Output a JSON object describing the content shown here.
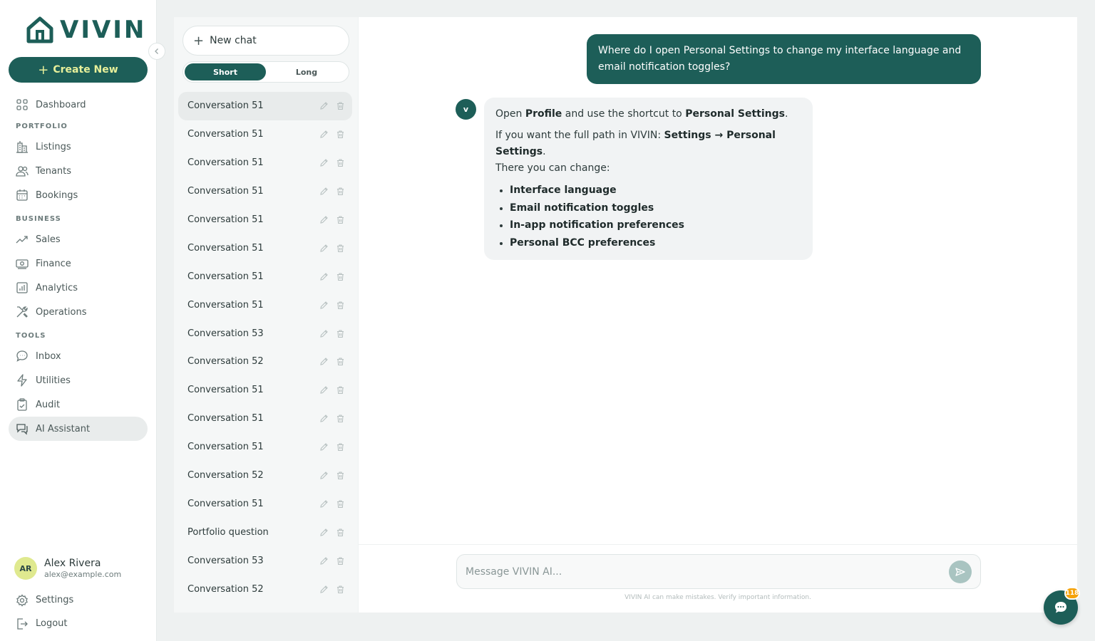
{
  "brand": {
    "name": "VIVIN",
    "color": "#1d5e58",
    "accent": "#e8f09a"
  },
  "sidebar": {
    "create_label": "Create New",
    "dashboard": "Dashboard",
    "sections": {
      "portfolio": "PORTFOLIO",
      "business": "BUSINESS",
      "tools": "TOOLS"
    },
    "items": {
      "listings": "Listings",
      "tenants": "Tenants",
      "bookings": "Bookings",
      "sales": "Sales",
      "finance": "Finance",
      "analytics": "Analytics",
      "operations": "Operations",
      "inbox": "Inbox",
      "utilities": "Utilities",
      "audit": "Audit",
      "ai_assistant": "AI Assistant"
    },
    "active_item": "AI Assistant",
    "user": {
      "initials": "AR",
      "name": "Alex Rivera",
      "email": "alex@example.com"
    },
    "settings": "Settings",
    "logout": "Logout"
  },
  "conversations": {
    "new_chat": "New chat",
    "mode_short": "Short",
    "mode_long": "Long",
    "active_mode": "Short",
    "items": [
      "Conversation 51",
      "Conversation 51",
      "Conversation 51",
      "Conversation 51",
      "Conversation 51",
      "Conversation 51",
      "Conversation 51",
      "Conversation 51",
      "Conversation 53",
      "Conversation 52",
      "Conversation 51",
      "Conversation 51",
      "Conversation 51",
      "Conversation 52",
      "Conversation 51",
      "Portfolio question",
      "Conversation 53",
      "Conversation 52"
    ]
  },
  "chat": {
    "user_message": "Where do I open Personal Settings to change my interface language and email notification toggles?",
    "bot_initial": "v",
    "bot": {
      "p1_a": "Open ",
      "p1_b": "Profile",
      "p1_c": " and use the shortcut to ",
      "p1_d": "Personal Settings",
      "p1_e": ".",
      "p2_a": "If you want the full path in VIVIN: ",
      "p2_b": "Settings → Personal Settings",
      "p2_c": ".",
      "p2_d": "There you can change:",
      "bullets": [
        "Interface language",
        "Email notification toggles",
        "In-app notification preferences",
        "Personal BCC preferences"
      ]
    },
    "input_placeholder": "Message VIVIN AI...",
    "disclaimer": "VIVIN AI can make mistakes. Verify important information."
  },
  "help": {
    "badge": "118"
  }
}
